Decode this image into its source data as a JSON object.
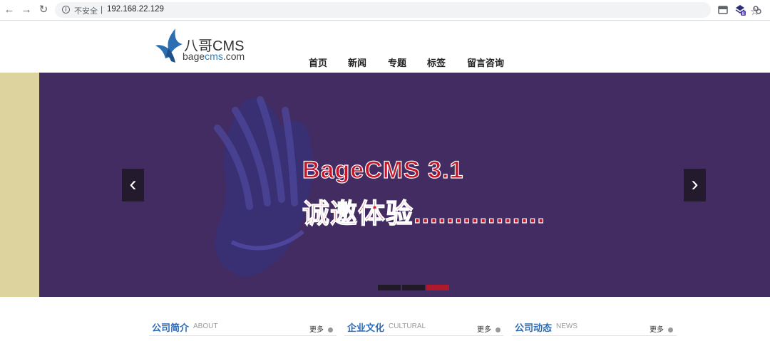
{
  "browser": {
    "back_icon": "arrow-left-icon",
    "forward_icon": "arrow-right-icon",
    "reload_icon": "reload-icon",
    "security_label": "不安全",
    "separator": "|",
    "url": "192.168.22.129",
    "ext_badge": "8"
  },
  "header": {
    "logo_title": "八哥CMS",
    "logo_sub_prefix": "bage",
    "logo_sub_accent": "cms",
    "logo_sub_suffix": ".com"
  },
  "nav": {
    "items": [
      "首页",
      "新闻",
      "专题",
      "标签",
      "留言咨询"
    ]
  },
  "banner": {
    "headline": "BageCMS 3.1",
    "subline": "诚邀体验................",
    "prev_label": "‹",
    "next_label": "›",
    "active_slide": 3,
    "slide_count": 3,
    "colors": {
      "background": "#432c61",
      "side": "#dcd39e",
      "text": "#c4162a",
      "active_dot": "#b0182c",
      "dot": "#1f1a26"
    }
  },
  "sections": [
    {
      "title": "公司简介",
      "subtitle": "ABOUT",
      "more": "更多"
    },
    {
      "title": "企业文化",
      "subtitle": "CULTURAL",
      "more": "更多"
    },
    {
      "title": "公司动态",
      "subtitle": "NEWS",
      "more": "更多"
    }
  ]
}
